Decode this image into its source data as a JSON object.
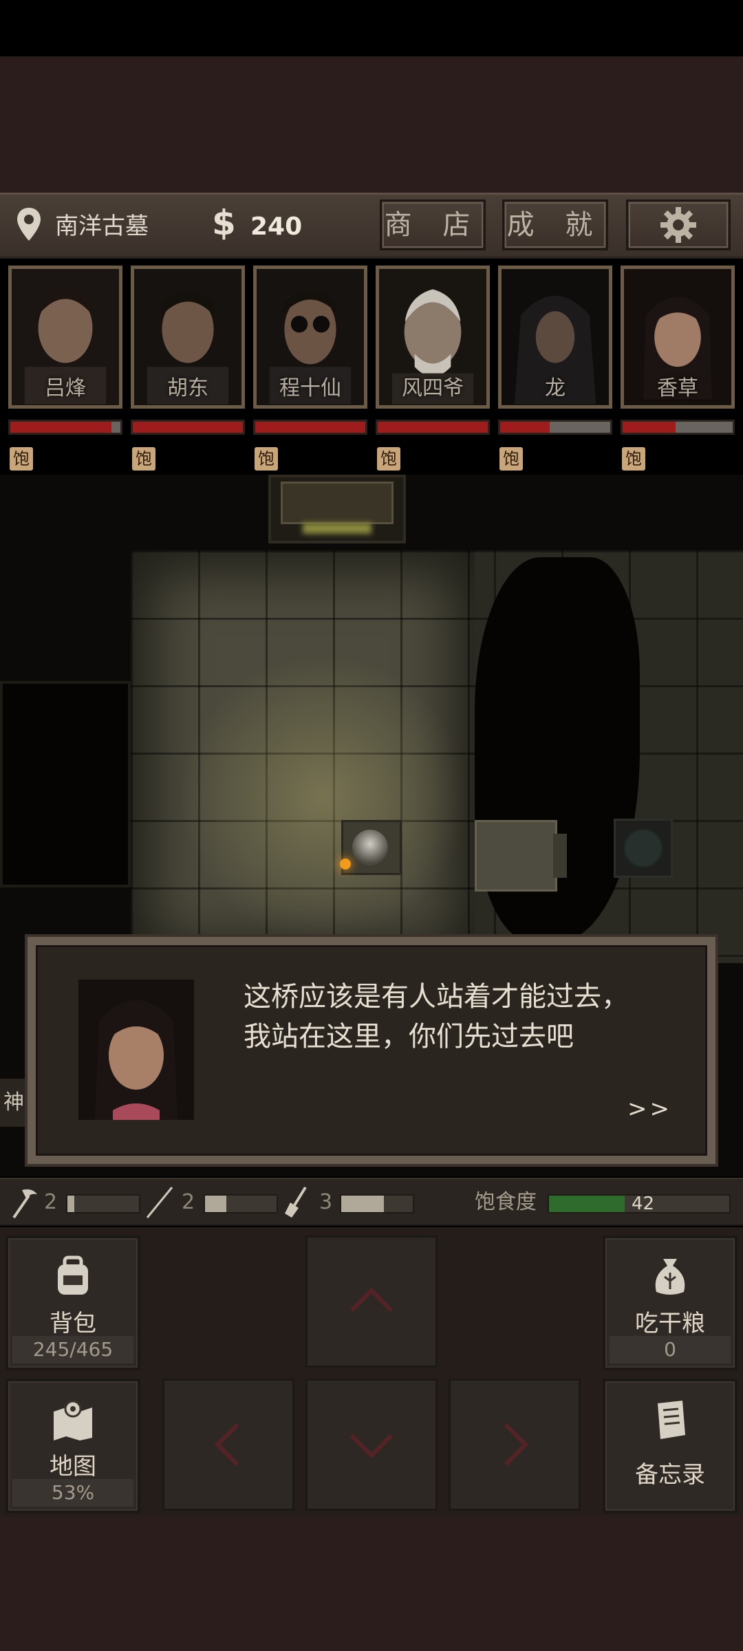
{
  "location": {
    "name": "南洋古墓",
    "icon": "location-pin-icon"
  },
  "money": {
    "symbol": "$",
    "amount": "240"
  },
  "buttons": {
    "shop": "商 店",
    "achievements": "成 就",
    "settings_icon": "gear-icon"
  },
  "party": [
    {
      "name": "吕烽",
      "hp": 0.92,
      "status": "饱"
    },
    {
      "name": "胡东",
      "hp": 1.0,
      "status": "饱"
    },
    {
      "name": "程十仙",
      "hp": 1.0,
      "status": "饱"
    },
    {
      "name": "风四爷",
      "hp": 1.0,
      "status": "饱"
    },
    {
      "name": "龙",
      "hp": 0.45,
      "status": "饱"
    },
    {
      "name": "香草",
      "hp": 0.48,
      "status": "饱"
    }
  ],
  "dialog": {
    "speaker": "香草",
    "line1": "这桥应该是有人站着才能过去，",
    "line2": "我站在这里，你们先过去吧",
    "next": ">>"
  },
  "side_fragment": "神",
  "tools": [
    {
      "icon": "pickaxe-icon",
      "count": "2",
      "level": 0.1
    },
    {
      "icon": "rod-icon",
      "count": "2",
      "level": 0.3
    },
    {
      "icon": "shovel-icon",
      "count": "3",
      "level": 0.6
    }
  ],
  "hunger": {
    "label": "饱食度",
    "value": "42",
    "level": 0.42
  },
  "controls": {
    "backpack": {
      "label": "背包",
      "sub": "245/465"
    },
    "eat": {
      "label": "吃干粮",
      "sub": "0"
    },
    "map": {
      "label": "地图",
      "sub": "53%"
    },
    "memo": {
      "label": "备忘录",
      "sub": ""
    }
  },
  "colors": {
    "health": "#9e1c1c",
    "hunger": "#2f6b2c",
    "status_badge": "#c9a67a"
  }
}
